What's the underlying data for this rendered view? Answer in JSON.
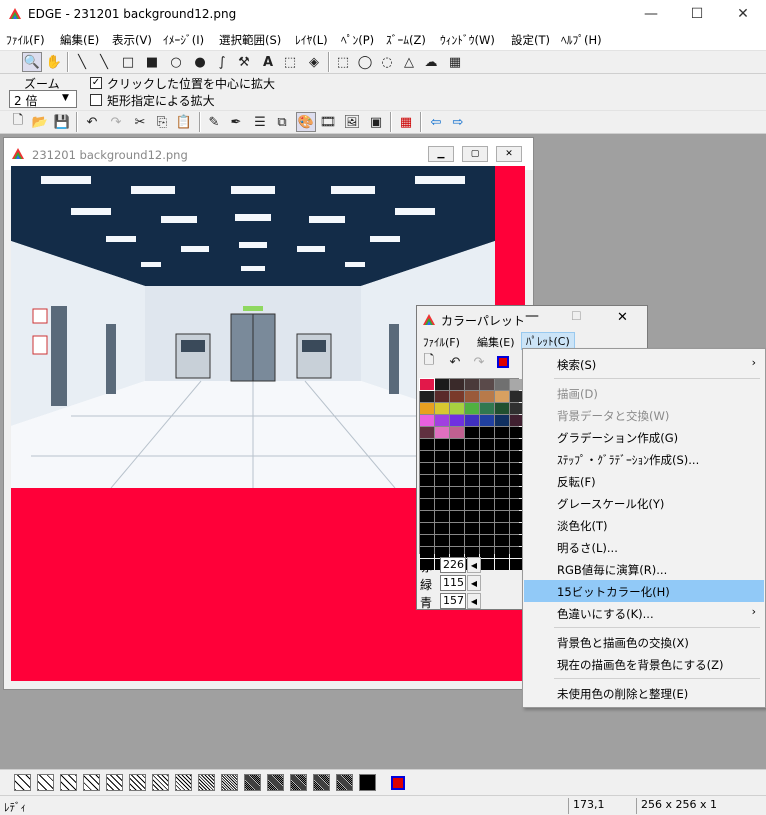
{
  "app": {
    "title": "EDGE - 231201 background12.png",
    "window_controls": {
      "minimize": "—",
      "maximize": "☐",
      "close": "✕"
    }
  },
  "menubar": [
    "ﾌｧｲﾙ(F)",
    "編集(E)",
    "表示(V)",
    "ｲﾒｰｼﾞ(I)",
    "選択範囲(S)",
    "ﾚｲﾔ(L)",
    "ﾍﾟﾝ(P)",
    "ｽﾞｰﾑ(Z)",
    "ｳｨﾝﾄﾞｳ(W)",
    "設定(T)",
    "ﾍﾙﾌﾟ(H)"
  ],
  "zoom": {
    "label": "ズーム",
    "value": "2 倍",
    "check_center": "クリックした位置を中心に拡大",
    "check_center_checked": true,
    "check_rect": "矩形指定による拡大",
    "check_rect_checked": false
  },
  "doc": {
    "title": "231201 background12.png",
    "bg_color": "#ff0039"
  },
  "palette": {
    "title": "カラーパレット",
    "menu": [
      "ﾌｧｲﾙ(F)",
      "編集(E)",
      "ﾊﾟﾚｯﾄ(C)"
    ],
    "swatches": [
      "#e2184a",
      "#1a1a1a",
      "#3a2a2a",
      "#4a3a3a",
      "#5a4a4a",
      "#707070",
      "#a8a8a8",
      "#202020",
      "#5a2a2a",
      "#7a3a2a",
      "#9a5a3a",
      "#b87a4a",
      "#d8a060",
      "#2a2a2a",
      "#e8a020",
      "#d8c830",
      "#a8d040",
      "#50b040",
      "#307850",
      "#205030",
      "#303030",
      "#e860e0",
      "#a040e0",
      "#7030e0",
      "#4030c0",
      "#2040a0",
      "#103060",
      "#402030",
      "#603040",
      "#e070c0",
      "#c06090",
      "#000000",
      "#000000",
      "#000000",
      "#000000"
    ],
    "r_label": "赤",
    "r_value": "226",
    "g_label": "緑",
    "g_value": "115",
    "b_label": "青",
    "b_value": "157"
  },
  "context_menu": {
    "items": [
      {
        "label": "検索(S)",
        "disabled": false,
        "submenu": true
      },
      {
        "label": "描画(D)",
        "disabled": true
      },
      {
        "label": "背景データと交換(W)",
        "disabled": true
      },
      {
        "label": "グラデーション作成(G)",
        "disabled": false
      },
      {
        "label": "ｽﾃｯﾌﾟ・ｸﾞﾗﾃﾞｰｼｮﾝ作成(S)...",
        "disabled": false
      },
      {
        "label": "反転(F)",
        "disabled": false
      },
      {
        "label": "グレースケール化(Y)",
        "disabled": false
      },
      {
        "label": "淡色化(T)",
        "disabled": false
      },
      {
        "label": "明るさ(L)...",
        "disabled": false
      },
      {
        "label": "RGB値毎に演算(R)...",
        "disabled": false
      },
      {
        "label": "15ビットカラー化(H)",
        "disabled": false,
        "highlighted": true
      },
      {
        "label": "色違いにする(K)...",
        "disabled": false,
        "submenu": true
      },
      {
        "label": "背景色と描画色の交換(X)",
        "disabled": false
      },
      {
        "label": "現在の描画色を背景色にする(Z)",
        "disabled": false
      },
      {
        "label": "未使用色の削除と整理(E)",
        "disabled": false
      }
    ]
  },
  "status": {
    "text": "ﾚﾃﾞｨ",
    "coords": "173,1",
    "size": "256 x 256 x 1"
  }
}
